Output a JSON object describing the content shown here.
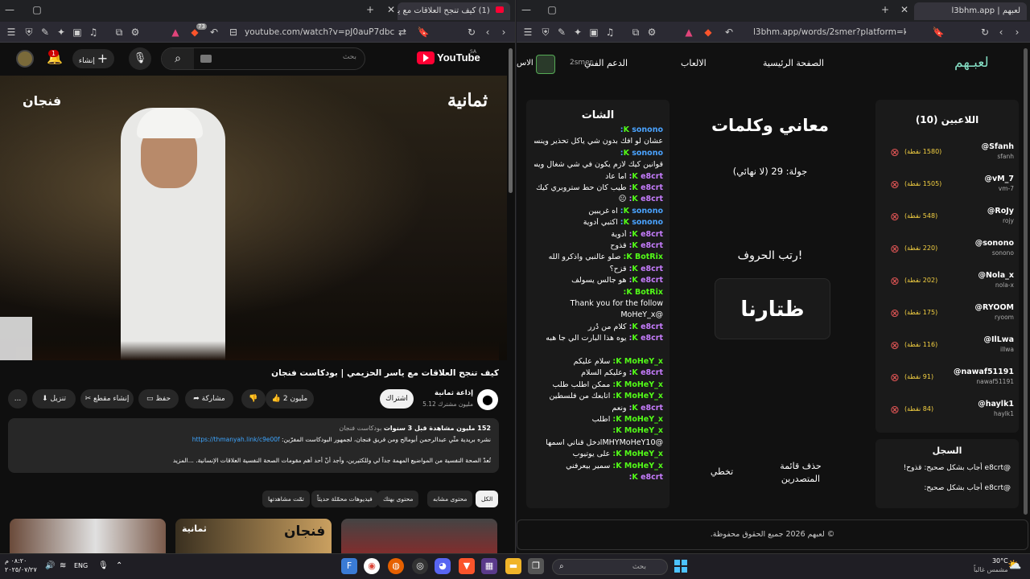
{
  "left_window": {
    "tab_title": "(1) كيف تنجح العلاقات مع ياسر ا",
    "tab_count_badge": "73",
    "url": "youtube.com/watch?v=pJ0auP7dbcY&t=1...",
    "youtube": {
      "logo": "YouTube",
      "country": "SA",
      "search_placeholder": "بحث",
      "create_label": "إنشاء",
      "notif_count": "1",
      "video_overlay_brand": "ثمانية",
      "video_overlay_show": "فنجان",
      "video_title": "كيف تنجح العلاقات مع ياسر الحزيمي | بودكاست فنجان",
      "channel_name": "إذاعة ثمانية",
      "subscribers": "5.12 مليون مشترك",
      "subscribe_label": "اشتراك",
      "like_count": "2 مليون",
      "share_label": "مشاركة",
      "save_label": "حفظ",
      "clip_label": "إنشاء مقطع",
      "download_label": "تنزيل",
      "more_label": "...",
      "desc_stats": "152 مليون مشاهدة قبل 3 سنوات",
      "desc_tag": "بودكاست فنجان",
      "desc_line1_pre": "نشره بريدية مثّي عبدالرحمن أبومالح ومن فريق فنجان، لجمهور البودكاست المفرّين:",
      "desc_link": "https://thmanyah.link/c9e00f",
      "desc_line2": "تُعدّ الصحة النفسية من المواضيع المهمة جداً لي وللكثيرين، وأجد أنّ أحد أهم مقومات الصحة النفسية العلاقات الإنسانية. ...المزيد",
      "chips": [
        "الكل",
        "محتوى مشابه",
        "محتوى بهتك",
        "فيديوهات محمّلة حديثاً",
        "تمّت مشاهدتها"
      ],
      "thumb2_brand": "ثمانية",
      "thumb2_show": "فنجان"
    }
  },
  "right_window": {
    "tab_title": "لعبهم | l3bhm.app",
    "url": "l3bhm.app/words/2smer?platform=kick",
    "nav": {
      "logo": "لعبـهم",
      "home": "الصفحة الرئيسية",
      "games": "الالعاب",
      "support": "الدعم الفني",
      "username": "2smer",
      "partial": "الاس"
    },
    "players_title": "اللاعبين (10)",
    "players": [
      {
        "name": "@Sfanh",
        "handle": "sfanh",
        "points": "(1580 نقطة)"
      },
      {
        "name": "@vM_7",
        "handle": "vm-7",
        "points": "(1505 نقطة)"
      },
      {
        "name": "@RoJy",
        "handle": "rojy",
        "points": "(548 نقطة)"
      },
      {
        "name": "@sonono",
        "handle": "sonono",
        "points": "(220 نقطة)"
      },
      {
        "name": "@Nola_x",
        "handle": "nola-x",
        "points": "(202 نقطة)"
      },
      {
        "name": "@RYOOM",
        "handle": "ryoom",
        "points": "(175 نقطة)"
      },
      {
        "name": "@IlLwa",
        "handle": "illwa",
        "points": "(116 نقطة)"
      },
      {
        "name": "@nawaf51191",
        "handle": "nawaf51191",
        "points": "(91 نقطة)"
      },
      {
        "name": "@haylk1",
        "handle": "haylk1",
        "points": "(84 نقطة)"
      }
    ],
    "log_title": "السجل",
    "log": [
      {
        "text": "@e8crt أجاب بشكل صحيح:",
        "word": "قذوح!"
      },
      {
        "text": "@e8crt أجاب بشكل صحيح:",
        "word": ""
      }
    ],
    "game_title": "معاني وكلمات",
    "round": "جولة: 29 (لا نهائي)",
    "instruction": "رتب الحروف!",
    "scrambled": "ظتارنا",
    "btn_clear": "حذف قائمة المتصدرين",
    "btn_skip": "تخطي",
    "chat_title": "الشات",
    "chat": [
      {
        "user": "sonono:",
        "color": "#4aa3ff",
        "msg": ""
      },
      {
        "user": "",
        "color": "",
        "msg": "عشان لو افك بدون شي ياكل تحذير وينسحب منه بارتنره"
      },
      {
        "user": "sonono:",
        "color": "#4aa3ff",
        "msg": ""
      },
      {
        "user": "",
        "color": "",
        "msg": "قوانين كيك لازم يكون في شي شغال ويسولف"
      },
      {
        "user": "e8crt:",
        "color": "#c77dff",
        "msg": "اما عاد"
      },
      {
        "user": "e8crt:",
        "color": "#c77dff",
        "msg": "طيب كان حط ستروبري كيك"
      },
      {
        "user": "e8crt:",
        "color": "#c77dff",
        "msg": "😐"
      },
      {
        "user": "sonono:",
        "color": "#4aa3ff",
        "msg": "اه غريبين"
      },
      {
        "user": "sonono:",
        "color": "#4aa3ff",
        "msg": "اكتبي أدوية"
      },
      {
        "user": "e8crt:",
        "color": "#c77dff",
        "msg": "أدوية"
      },
      {
        "user": "e8crt:",
        "color": "#c77dff",
        "msg": "قذوح"
      },
      {
        "user": "BotRix:",
        "color": "#53fc18",
        "msg": "صلو عالنبي واذكرو الله"
      },
      {
        "user": "e8crt:",
        "color": "#c77dff",
        "msg": "قزح؟"
      },
      {
        "user": "e8crt:",
        "color": "#c77dff",
        "msg": "هو جالس يسولف"
      },
      {
        "user": "BotRix:",
        "color": "#53fc18",
        "msg": ""
      },
      {
        "user": "",
        "color": "",
        "msg": "Thank you for the follow"
      },
      {
        "user": "",
        "color": "",
        "msg": "@MoHeY_x"
      },
      {
        "user": "e8crt:",
        "color": "#c77dff",
        "msg": "كلام من دُرر"
      },
      {
        "user": "e8crt:",
        "color": "#c77dff",
        "msg": "يوه هذا البارت الي جا هبه"
      },
      {
        "user": "",
        "color": "",
        "msg": ""
      },
      {
        "user": "MoHeY_x:",
        "color": "#53fc18",
        "msg": "سلام عليكم"
      },
      {
        "user": "e8crt:",
        "color": "#c77dff",
        "msg": "وعليكم السلام"
      },
      {
        "user": "MoHeY_x:",
        "color": "#53fc18",
        "msg": "ممكن اطلب طلب"
      },
      {
        "user": "MoHeY_x:",
        "color": "#53fc18",
        "msg": "اتابعك من فلسطين"
      },
      {
        "user": "e8crt:",
        "color": "#c77dff",
        "msg": "ونعم"
      },
      {
        "user": "MoHeY_x:",
        "color": "#53fc18",
        "msg": "اطلب"
      },
      {
        "user": "MoHeY_x:",
        "color": "#53fc18",
        "msg": ""
      },
      {
        "user": "",
        "color": "",
        "msg": "@MHYMoHeY10ادخل قناتي اسمها"
      },
      {
        "user": "MoHeY_x:",
        "color": "#53fc18",
        "msg": "على يوتيوب"
      },
      {
        "user": "MoHeY_x:",
        "color": "#53fc18",
        "msg": "سمير بيعرفني"
      },
      {
        "user": "e8crt:",
        "color": "#c77dff",
        "msg": ""
      }
    ],
    "footer": "© لعبهم 2026 جميع الحقوق محفوظة."
  },
  "taskbar": {
    "weather_temp": "30°C",
    "weather_desc": "مشمس غالباً",
    "search_placeholder": "بحث",
    "lang": "ENG",
    "time": "٠٨:٢٠ م",
    "date": "٢٠٢٥/٠٧/٢٧"
  }
}
